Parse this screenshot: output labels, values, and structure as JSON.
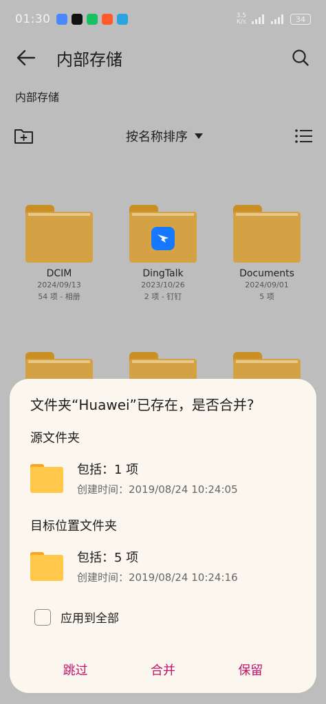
{
  "status": {
    "time": "01:30",
    "net_speed_value": "3.5",
    "net_speed_unit": "K/s",
    "battery": "34"
  },
  "header": {
    "title": "内部存储",
    "back_icon": "arrow-left-icon",
    "search_icon": "search-icon"
  },
  "breadcrumb": "内部存储",
  "toolbar": {
    "sort_label": "按名称排序",
    "new_folder_icon": "new-folder-icon",
    "list_icon": "list-view-icon"
  },
  "folders": [
    {
      "name": "DCIM",
      "date": "2024/09/13",
      "meta": "54 项 - 相册"
    },
    {
      "name": "DingTalk",
      "date": "2023/10/26",
      "meta": "2 项 - 钉钉"
    },
    {
      "name": "Documents",
      "date": "2024/09/01",
      "meta": "5 项"
    }
  ],
  "dialog": {
    "title": "文件夹“Huawei”已存在，是否合并?",
    "source_label": "源文件夹",
    "source_count": "包括：1 项",
    "source_created_label": "创建时间：",
    "source_created": "2019/08/24 10:24:05",
    "target_label": "目标位置文件夹",
    "target_count": "包括：5 项",
    "target_created_label": "创建时间：",
    "target_created": "2019/08/24 10:24:16",
    "apply_all": "应用到全部",
    "skip": "跳过",
    "merge": "合并",
    "keep": "保留"
  },
  "colors": {
    "accent": "#c1126b",
    "folder": "#d4a244",
    "dialog_folder": "#ffc84a"
  }
}
